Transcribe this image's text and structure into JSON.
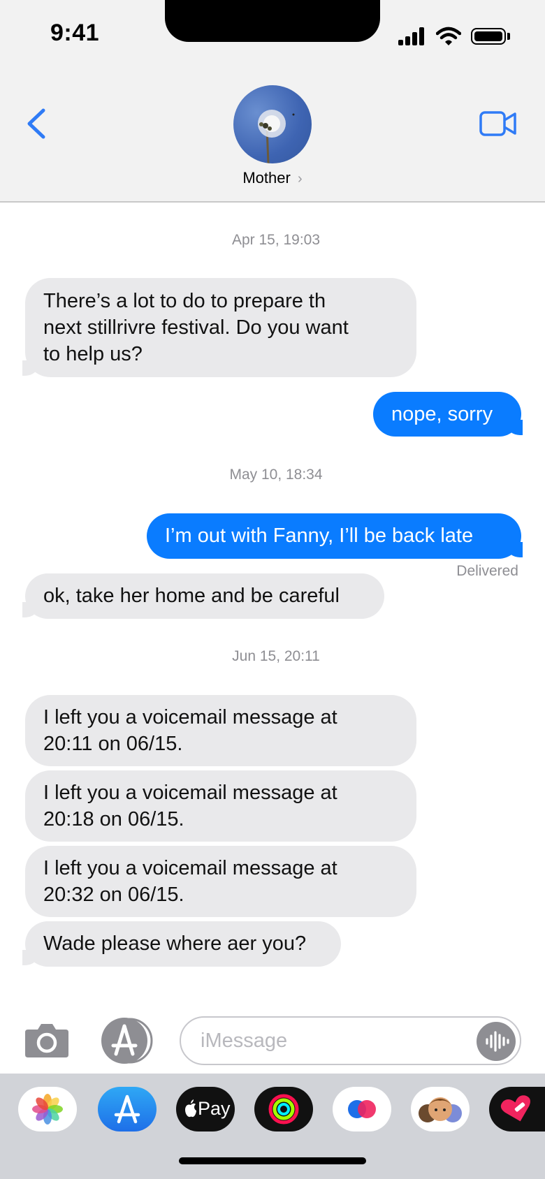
{
  "status_bar": {
    "time": "9:41"
  },
  "header": {
    "contact_name": "Mother",
    "back_icon": "chevron-left-icon",
    "video_icon": "video-camera-icon"
  },
  "messages": {
    "ts1": "Apr 15, 19:03",
    "m1_l1": "There’s a lot to  do to prepare th",
    "m1_l2": "next  stillrivre festival.  Do you want",
    "m1_l3": "to help us?",
    "m2": "nope, sorry",
    "ts2": "May 10, 18:34",
    "m3": "I’m out with Fanny, I’ll be back late",
    "delivered": "Delivered",
    "m4": "ok, take her home and be careful",
    "ts3": "Jun 15, 20:11",
    "m5_l1": "I left you a voicemail message at",
    "m5_l2": "20:11 on 06/15.",
    "m6_l1": "I left you a voicemail message at",
    "m6_l2": "20:18 on 06/15.",
    "m7_l1": "I left you a voicemail message at",
    "m7_l2": "20:32 on 06/15.",
    "m8": "Wade please where aer you?"
  },
  "input_bar": {
    "placeholder": "iMessage"
  },
  "app_drawer": {
    "apps": [
      "photos-icon",
      "app-store-icon",
      "apple-pay-icon",
      "fitness-icon",
      "digital-touch-icon",
      "memoji-icon",
      "heart-sticker-icon"
    ],
    "apple_pay_label": "Pay"
  },
  "colors": {
    "outgoing": "#0a7cff",
    "incoming": "#e9e9eb",
    "accent": "#2f7bf6"
  }
}
